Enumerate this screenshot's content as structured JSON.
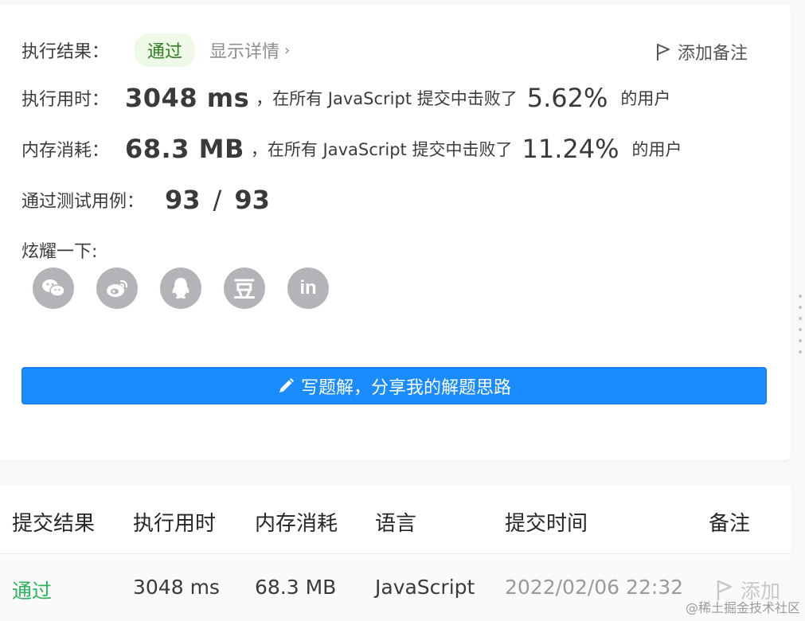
{
  "result": {
    "label": "执行结果：",
    "status": "通过",
    "details_link": "显示详情",
    "details_chevron": "›",
    "add_note": "添加备注"
  },
  "runtime": {
    "label": "执行用时：",
    "value": "3048 ms",
    "text_before": "，在所有 JavaScript 提交中击败了",
    "percent": "5.62%",
    "text_after": "的用户"
  },
  "memory": {
    "label": "内存消耗：",
    "value": "68.3 MB",
    "text_before": "，在所有 JavaScript 提交中击败了",
    "percent": "11.24%",
    "text_after": "的用户"
  },
  "tests": {
    "label": "通过测试用例：",
    "passed": "93",
    "separator": "/",
    "total": "93"
  },
  "share": {
    "label": "炫耀一下:",
    "icons": [
      "wechat-icon",
      "weibo-icon",
      "qq-icon",
      "douban-icon",
      "linkedin-icon"
    ],
    "douban_glyph": "豆",
    "linkedin_glyph": "in"
  },
  "cta": {
    "label": "写题解，分享我的解题思路"
  },
  "table": {
    "headers": [
      "提交结果",
      "执行用时",
      "内存消耗",
      "语言",
      "提交时间",
      "备注"
    ],
    "row": {
      "result": "通过",
      "runtime": "3048 ms",
      "memory": "68.3 MB",
      "language": "JavaScript",
      "time": "2022/02/06 22:32",
      "note": "添加"
    }
  },
  "watermark": "@稀土掘金技术社区",
  "colors": {
    "accent": "#1a8cff",
    "pass_green": "#2db55d",
    "icon_gray": "#b2b4b8"
  }
}
